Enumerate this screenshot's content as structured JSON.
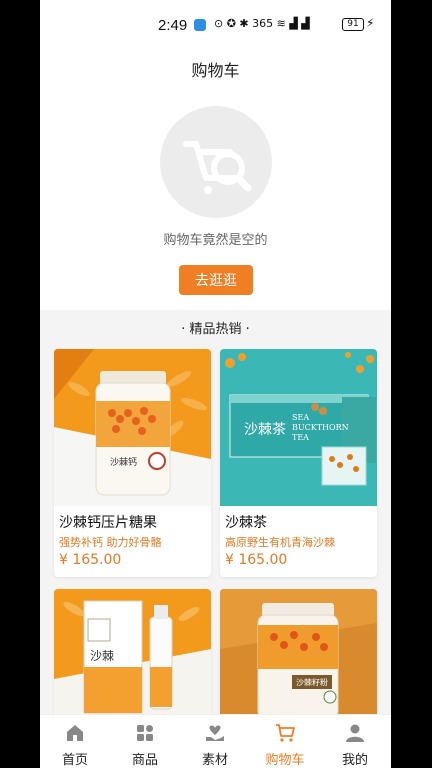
{
  "status_bar": {
    "time": "2:49",
    "indicators": "⊙ ✪ ✱ 365 ≋ ▟ ▟",
    "battery": "91"
  },
  "header": {
    "title": "购物车"
  },
  "empty_state": {
    "icon": "cart-search-icon",
    "message": "购物车竟然是空的",
    "button_label": "去逛逛"
  },
  "section": {
    "title": "· 精品热销 ·"
  },
  "products": [
    {
      "name": "沙棘钙压片糖果",
      "desc": "强势补钙 助力好骨骼",
      "price": "¥ 165.00",
      "bottle_label": "沙棘钙"
    },
    {
      "name": "沙棘茶",
      "desc": "高原野生有机青海沙棘",
      "price": "¥ 165.00",
      "box_label": "沙棘茶",
      "box_en": "SEA BUCKTHORN TEA"
    },
    {
      "name": "",
      "desc": "",
      "price": "",
      "box_label": "沙棘"
    },
    {
      "name": "",
      "desc": "",
      "price": "",
      "bottle_label": "沙棘籽粉"
    }
  ],
  "tabbar": {
    "tabs": [
      {
        "label": "首页",
        "icon": "home-icon"
      },
      {
        "label": "商品",
        "icon": "grid-icon"
      },
      {
        "label": "素材",
        "icon": "heart-hand-icon"
      },
      {
        "label": "购物车",
        "icon": "cart-icon",
        "active": true
      },
      {
        "label": "我的",
        "icon": "user-icon"
      }
    ]
  },
  "colors": {
    "accent": "#f07e22",
    "price": "#e57a22",
    "teal": "#3bb8b6"
  }
}
